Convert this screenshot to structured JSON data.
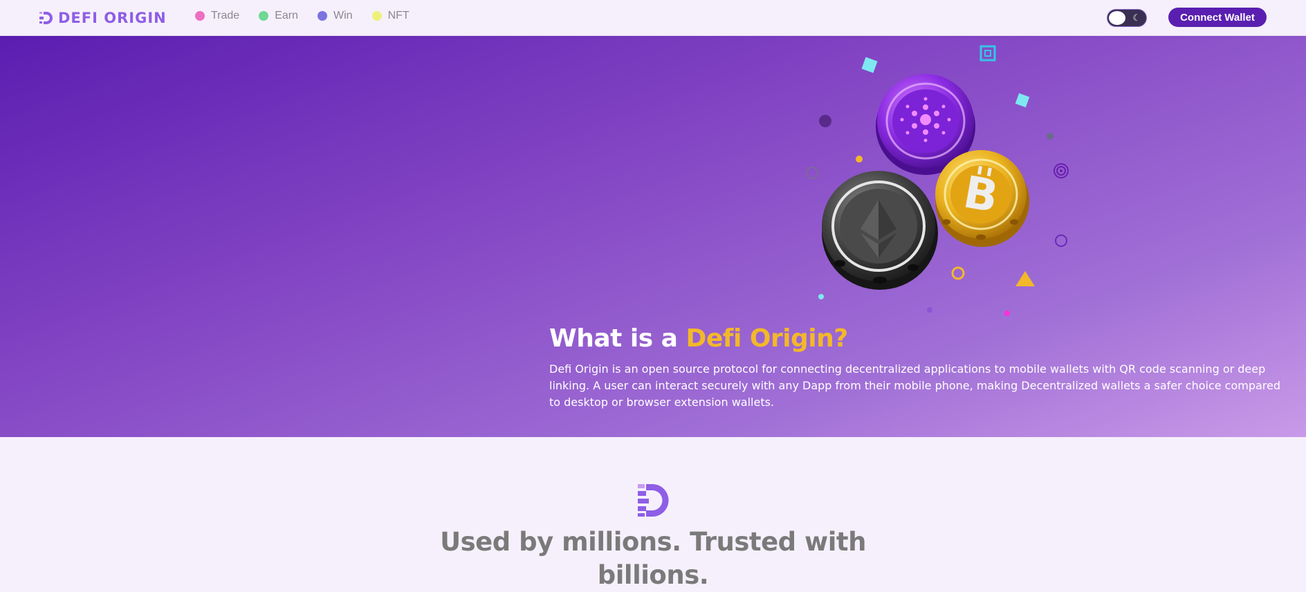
{
  "brand": {
    "name": "DEFI ORIGIN"
  },
  "nav": {
    "items": [
      {
        "label": "Trade",
        "dot_color": "#ec6fc2"
      },
      {
        "label": "Earn",
        "dot_color": "#6ed894"
      },
      {
        "label": "Win",
        "dot_color": "#7a73e0"
      },
      {
        "label": "NFT",
        "dot_color": "#eef07c"
      }
    ],
    "theme_toggle": {
      "icon": "moon-icon",
      "state": "light"
    },
    "connect_label": "Connect Wallet"
  },
  "hero": {
    "title_prefix": "What is a ",
    "title_accent": "Defi Origin?",
    "description": "Defi Origin is an open source protocol for connecting decentralized applications to mobile wallets with QR code scanning or deep linking. A user can interact securely with any Dapp from their mobile phone, making Decentralized wallets a safer choice compared to desktop or browser extension wallets.",
    "illustration": [
      "cardano-coin",
      "ethereum-coin",
      "bitcoin-coin"
    ]
  },
  "section": {
    "heading_line1": "Used by millions. Trusted with",
    "heading_line2": "billions."
  },
  "colors": {
    "accent": "#f3b829",
    "brand": "#5a1fb0",
    "logo": "#8e5ee6"
  }
}
